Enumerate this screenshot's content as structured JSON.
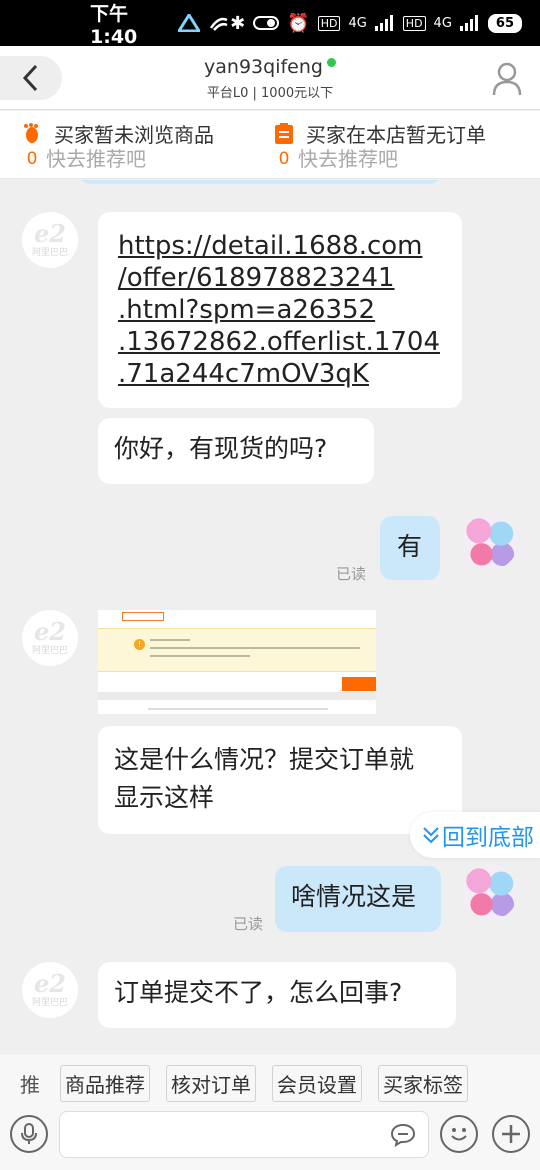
{
  "status_bar": {
    "time": "下午1:40",
    "battery": "65",
    "net1": "4G",
    "net2": "4G"
  },
  "header": {
    "title": "yan93qifeng",
    "subtitle": "平台L0 | 1000元以下"
  },
  "info_bar": {
    "browse": {
      "text": "买家暂未浏览商品",
      "sub": "快去推荐吧",
      "count": "0"
    },
    "order": {
      "text": "买家在本店暂无订单",
      "sub": "快去推荐吧",
      "count": "0"
    }
  },
  "avatar_left": {
    "mark": "e2",
    "name": "阿里巴巴"
  },
  "messages": {
    "m1": "https://detail.1688.com\n/offer/618978823241\n.html?spm=a26352\n.13672862.offerlist.1704\n.71a244c7mOV3qK",
    "m2": "你好，有现货的吗?",
    "m3": "有",
    "m3_read": "已读",
    "m5": "这是什么情况？提交订单就\n显示这样",
    "m6": "啥情况这是",
    "m6_read": "已读",
    "m7": "订单提交不了，怎么回事?"
  },
  "back_to_bottom": "回到底部",
  "quick_actions": {
    "prefix": "推",
    "items": [
      "商品推荐",
      "核对订单",
      "会员设置",
      "买家标签"
    ]
  },
  "colors": {
    "accent": "#ff6a00",
    "bubble_me": "#cbe8fb",
    "link_blue": "#2196f3",
    "online": "#2cc94a"
  }
}
